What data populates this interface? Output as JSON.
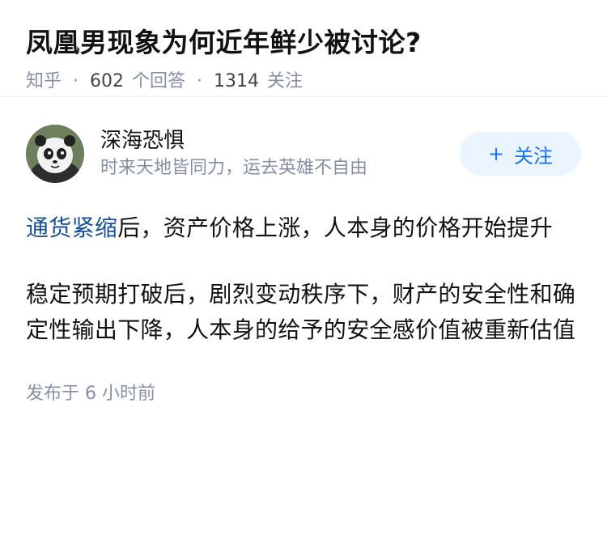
{
  "question": {
    "title": "凤凰男现象为何近年鲜少被讨论?",
    "source": "知乎",
    "answer_count": "602",
    "answer_label": "个回答",
    "follower_count": "1314",
    "follower_label": "关注"
  },
  "author": {
    "name": "深海恐惧",
    "bio": "时来天地皆同力，运去英雄不自由",
    "follow_label": "关注",
    "avatar_icon": "panda-avatar"
  },
  "answer": {
    "link_text": "通货紧缩",
    "paragraph1_rest": "后，资产价格上涨，人本身的价格开始提升",
    "paragraph2": "稳定预期打破后，剧烈变动秩序下，财产的安全性和确定性输出下降，人本身的给予的安全感价值被重新估值",
    "posted_time": "发布于  6 小时前"
  }
}
